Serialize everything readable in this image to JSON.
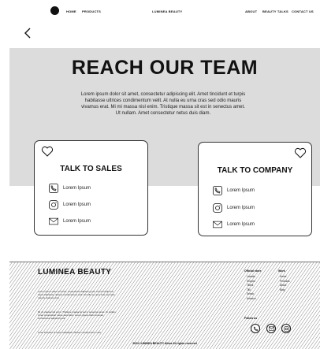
{
  "header": {
    "nav_left": [
      "HOME",
      "PRODUCTS"
    ],
    "brand": "LUMINEA BEAUTY",
    "nav_right": [
      "ABOUT",
      "BEAUTY TALKS",
      "CONTACT US"
    ]
  },
  "back_icon": "chevron-left-icon",
  "hero": {
    "title": "REACH OUR TEAM",
    "text": "Lorem ipsum dolor sit amet, consectetur adipiscing elit. Amet tincidunt et turpis habitasse ultrices condimentum velit. At nulla eu urna cras sed odio mauris vivamus erat. Mi mi massa nisl enim. Tristique massa sit est in senectus amet. Ut nullam. Amet consectetur netus duis diam."
  },
  "cards": [
    {
      "title": "TALK TO SALES",
      "rows": [
        {
          "icon": "phone-icon",
          "label": "Lorem Ipsum"
        },
        {
          "icon": "instagram-icon",
          "label": "Lorem Ipsum"
        },
        {
          "icon": "mail-icon",
          "label": "Lorem Ipsum"
        }
      ]
    },
    {
      "title": "TALK TO COMPANY",
      "rows": [
        {
          "icon": "phone-icon",
          "label": "Lorem Ipsum"
        },
        {
          "icon": "instagram-icon",
          "label": "Lorem Ipsum"
        },
        {
          "icon": "mail-icon",
          "label": "Lorem Ipsum"
        }
      ]
    }
  ],
  "footer": {
    "brand": "LUMINEA BEAUTY",
    "paragraphs": [
      "Lorem ipsum dolor sit amet, consectetur adipiscing elit. Amet tincidunt et turpis habitasse ultrices condimentum velit. At nulla eu urna cras sed odio mauris vivamus erat.",
      "Mi mi massa nisl enim. Tristique massa sit est in senectus amet. Ut nullam. Amet consectetur netus duis diam. Lorem ipsum dolor sit amet, consectetur adipiscing elit.",
      "Amet tincidunt et turpis habitasse ultrices condimentum velit."
    ],
    "col1_title": "Official store",
    "col1_items": [
      "Lazada",
      "Shopee",
      "Tiktok",
      "Tiki",
      "Sendo",
      "Amazon"
    ],
    "col2_title": "Work",
    "col2_items": [
      "Home",
      "Products",
      "About",
      "Blog"
    ],
    "follow_title": "Follow us",
    "copyright": "2024 LUMINEA BEAUTY Allow All rights reserved"
  }
}
